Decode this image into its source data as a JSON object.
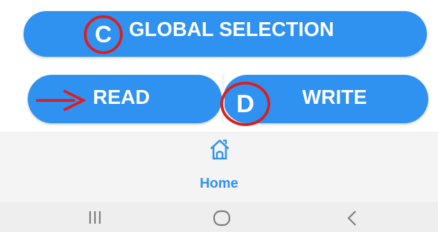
{
  "buttons": {
    "global_selection": "GLOBAL SELECTION",
    "read": "READ",
    "write": "WRITE"
  },
  "annotations": {
    "marker_c": "C",
    "marker_d": "D"
  },
  "bottom_nav": {
    "home_label": "Home",
    "home_icon": "home-icon"
  },
  "system_nav": {
    "recents_icon": "recents-icon",
    "home_icon": "circle-home-icon",
    "back_icon": "back-chevron-icon"
  },
  "colors": {
    "primary": "#2f92f0",
    "annotation": "#e01c1c"
  }
}
